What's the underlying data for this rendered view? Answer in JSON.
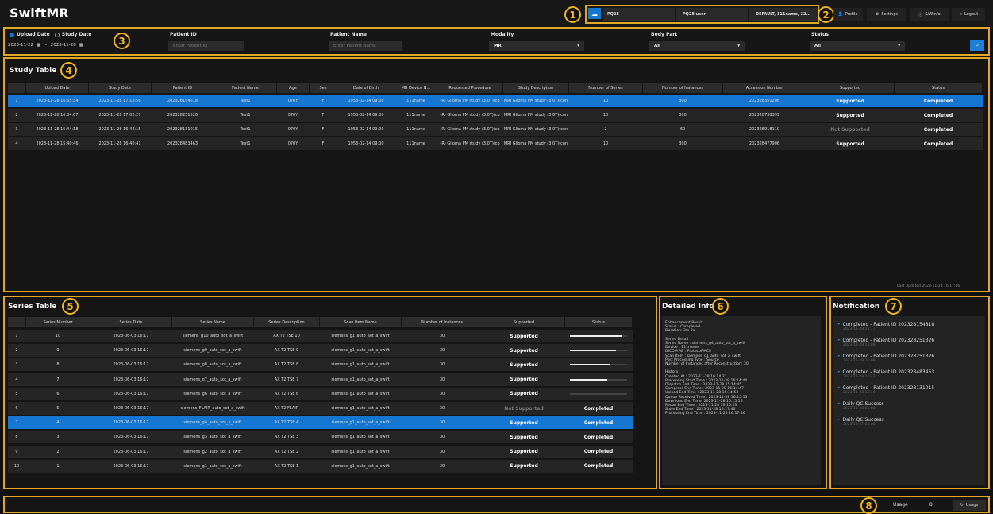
{
  "app": {
    "title": "SwiftMR"
  },
  "header": {
    "site_code": "PQ28",
    "user": "PQ28 user",
    "device": "DEFAULT, 111name, 22...",
    "profile_label": "Profile",
    "settings_label": "Settings",
    "swinfo_label": "S/WInfo",
    "logout_label": "Logout"
  },
  "callouts": [
    "1",
    "2",
    "3",
    "4",
    "5",
    "6",
    "7",
    "8"
  ],
  "filters": {
    "upload_date_label": "Upload Date",
    "study_date_label": "Study Date",
    "date_from": "2023-11-22",
    "date_sep": "~",
    "date_to": "2023-11-28",
    "patient_id_label": "Patient ID",
    "patient_id_placeholder": "Enter Patient ID",
    "patient_name_label": "Patient Name",
    "patient_name_placeholder": "Enter Patient Name",
    "modality_label": "Modality",
    "modality_value": "MR",
    "body_part_label": "Body Part",
    "body_part_value": "All",
    "status_label": "Status",
    "status_value": "All"
  },
  "study_table": {
    "title": "Study Table",
    "columns": [
      "",
      "Upload Date",
      "Study Date",
      "Patient ID",
      "Patient Name",
      "Age",
      "Sex",
      "Date of Birth",
      "MR Device N...",
      "Requested Procedure",
      "Study Description",
      "Number of Series",
      "Number of Instances",
      "Accession Number",
      "Supported",
      "Status"
    ],
    "rows": [
      [
        "1",
        "2023-11-28 16:55:34",
        "2023-11-28 17:13:56",
        "202328154818",
        "Test1",
        "070Y",
        "F",
        "1953-02-14 09:00",
        "111name",
        "(R) Glioma PM study (3.0T)(co",
        "MRI Glioma PM study (3.0T)(con",
        "10",
        "300",
        "202328351208",
        "Supported",
        "Completed"
      ],
      [
        "2",
        "2023-11-28 16:04:07",
        "2023-11-28 17:02:27",
        "202328251326",
        "Test1",
        "070Y",
        "F",
        "1953-02-14 09:00",
        "111name",
        "(R) Glioma PM study (3.0T)(co",
        "MRI Glioma PM study (3.0T)(con",
        "10",
        "300",
        "202328738399",
        "Supported",
        "Completed"
      ],
      [
        "3",
        "2023-11-28 15:44:18",
        "2023-11-28 16:44:15",
        "202328131015",
        "Test1",
        "070Y",
        "F",
        "1953-02-14 09:00",
        "111name",
        "(R) Glioma PM study (3.0T)(co",
        "MRI Glioma PM study (3.0T)(con",
        "2",
        "60",
        "202328918110",
        "Not Supported",
        "Completed"
      ],
      [
        "4",
        "2023-11-28 15:40:46",
        "2023-11-28 16:40:41",
        "202328483463",
        "Test1",
        "070Y",
        "F",
        "1953-02-14 09:00",
        "111name",
        "(R) Glioma PM study (3.0T)(co",
        "MRI Glioma PM study (3.0T)(con",
        "10",
        "300",
        "202328477906",
        "Supported",
        "Completed"
      ]
    ],
    "last_updated": "Last Updated 2023-11-28 16:17:46"
  },
  "series_table": {
    "title": "Series Table",
    "columns": [
      "",
      "Series Number",
      "Series Date",
      "Series Name",
      "Series Description",
      "Scan Item Name",
      "Number of Instances",
      "Supported",
      "Status"
    ],
    "rows": [
      [
        "1",
        "10",
        "2023-06-03 16:17",
        "siemens_g10_auto_sot_a_swift",
        "AX T2 TSE 10",
        "siemens_g1_auto_sot_a_swift",
        "30",
        "Supported",
        ""
      ],
      [
        "2",
        "9",
        "2023-06-03 16:17",
        "siemens_g9_auto_sot_a_swift",
        "AX T2 TSE 9",
        "siemens_g1_auto_sot_a_swift",
        "30",
        "Supported",
        ""
      ],
      [
        "3",
        "8",
        "2023-06-03 16:17",
        "siemens_g8_auto_sot_a_swift",
        "AX T2 TSE 8",
        "siemens_g1_auto_sot_a_swift",
        "30",
        "Supported",
        ""
      ],
      [
        "4",
        "7",
        "2023-06-03 16:17",
        "siemens_g7_auto_sot_a_swift",
        "AX T2 TSE 7",
        "siemens_g1_auto_sot_a_swift",
        "30",
        "Supported",
        ""
      ],
      [
        "5",
        "6",
        "2023-06-03 16:17",
        "siemens_g6_auto_sot_a_swift",
        "AX T2 TSE 6",
        "siemens_g1_auto_sot_a_swift",
        "30",
        "Supported",
        ""
      ],
      [
        "6",
        "5",
        "2023-06-03 16:17",
        "siemens_FLAIR_auto_sot_a_swift",
        "AX T2 FLAIR",
        "siemens_g1_auto_sot_a_swift",
        "30",
        "Not Supported",
        "Completed"
      ],
      [
        "7",
        "4",
        "2023-06-03 16:17",
        "siemens_g4_auto_sot_a_swift",
        "AX T2 TSE 4",
        "siemens_g1_auto_sot_a_swift",
        "30",
        "Supported",
        "Completed"
      ],
      [
        "8",
        "3",
        "2023-06-03 16:17",
        "siemens_g3_auto_sot_a_swift",
        "AX T2 TSE 3",
        "siemens_g1_auto_sot_a_swift",
        "30",
        "Supported",
        "Completed"
      ],
      [
        "9",
        "2",
        "2023-06-03 16:17",
        "siemens_g2_auto_sot_a_swift",
        "AX T2 TSE 2",
        "siemens_g1_auto_sot_a_swift",
        "30",
        "Supported",
        "Completed"
      ],
      [
        "10",
        "1",
        "2023-06-03 16:17",
        "siemens_g1_auto_sot_a_swift",
        "AX T2 TSE 1",
        "siemens_g1_auto_sot_a_swift",
        "30",
        "Supported",
        "Completed"
      ]
    ],
    "progress": [
      0.9,
      0.8,
      0.7,
      0.65,
      0
    ]
  },
  "detail": {
    "title": "Detailed Info",
    "text": "Enhancement Result\nStatus : Completed\nDuration: 3m 2s\n\nSeries Detail\nSeries Name : siemens_g4_auto_sot_a_swift\nDevice : 111name\nDICOM AE : ProtocolPACS\nScan Item : siemens_g1_auto_sot_a_swift\nPost Processing Type : Source\nNumber of Instances after Reconstruction: 30\n\nHistory\nCreated At : 2023-11-28 16:14:21\nProcessing Start Time : 2023-11-28 16:14:44\nDispatch End Time : 2023-11-28 15:14:45\nCompress End Time : 2023-11-28 16:14:47\nUpload End Time : 2023-11-28 16:14:53\nQueue Received Time : 2023-11-28 16:15:13\nDownload End Time: 2023-11-28 16:15:16\nRecon End Time : 2023-11-28 16:16:23\nStore End Time : 2023-11-28 16:17:46\nProcessing End Time : 2023-11-28 16:17:46"
  },
  "notifications": {
    "title": "Notification",
    "items": [
      {
        "text": "Completed - Patient ID 202328154818",
        "time": "2023-11-28 16:17"
      },
      {
        "text": "Completed - Patient ID 202328251326",
        "time": "2023-11-28 16:08"
      },
      {
        "text": "Completed - Patient ID 202328251326",
        "time": "2023-11-28 16:08"
      },
      {
        "text": "Completed - Patient ID 202328483463",
        "time": "2023-11-28 15:47"
      },
      {
        "text": "Completed - Patient ID 202328131015",
        "time": "2023-11-28 15:44"
      },
      {
        "text": "Daily QC Success",
        "time": "2023-11-28 01:00"
      },
      {
        "text": "Daily QC Success",
        "time": "2023-11-27 01:00"
      }
    ]
  },
  "footer": {
    "usage_label": "Usage",
    "usage_value": "8",
    "usage_button": "Usage"
  },
  "colors": {
    "accent": "#1677d2",
    "callout": "#f2b51b"
  }
}
